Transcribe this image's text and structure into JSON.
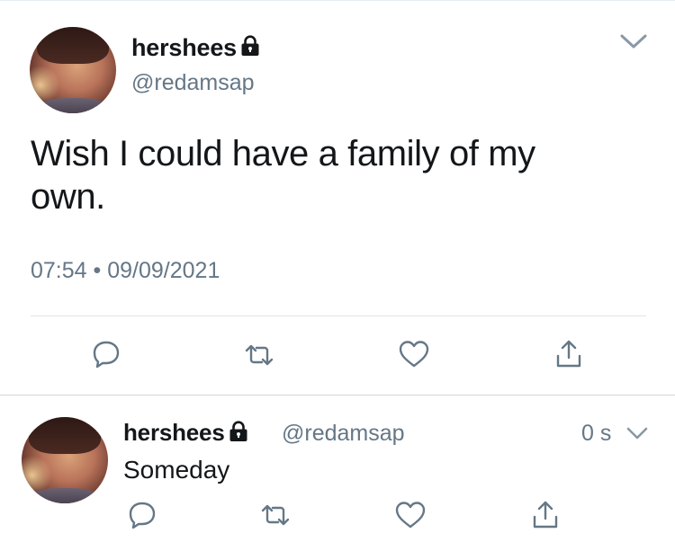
{
  "tweet": {
    "display_name": "hershees",
    "handle": "@redamsap",
    "text": "Wish I could have a family of my own.",
    "time": "07:54",
    "separator": "•",
    "date": "09/09/2021"
  },
  "reply": {
    "display_name": "hershees",
    "handle": "@redamsap",
    "relative_time": "0 s",
    "text": "Someday"
  },
  "icons": {
    "lock": "lock-icon",
    "chevron": "chevron-down-icon",
    "reply": "reply-icon",
    "retweet": "retweet-icon",
    "like": "heart-icon",
    "share": "share-icon"
  },
  "colors": {
    "text": "#14171a",
    "secondary": "#657786",
    "divider": "#e6ecf0"
  }
}
